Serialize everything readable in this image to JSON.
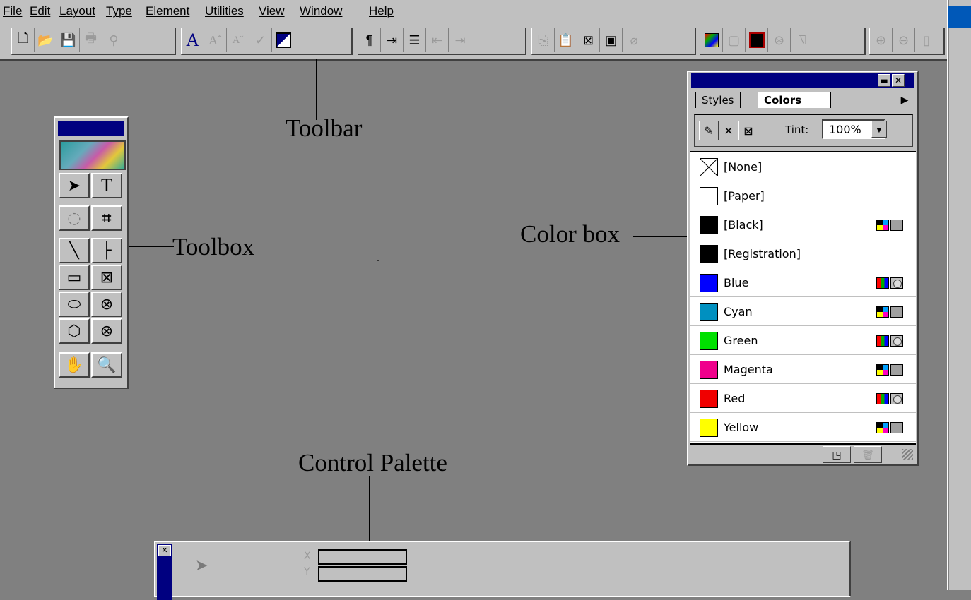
{
  "menu": [
    {
      "label": "File"
    },
    {
      "label": "Edit"
    },
    {
      "label": "Layout"
    },
    {
      "label": "Type"
    },
    {
      "label": "Element"
    },
    {
      "label": "Utilities"
    },
    {
      "label": "View"
    },
    {
      "label": "Window"
    },
    {
      "label": "Help"
    }
  ],
  "annotations": {
    "toolbar": "Toolbar",
    "toolbox": "Toolbox",
    "color_box": "Color box",
    "control_palette": "Control Palette"
  },
  "toolbar_icons": [
    "new-icon",
    "open-icon",
    "save-icon",
    "print-icon",
    "find-icon",
    "font-icon",
    "font-bigger-icon",
    "font-smaller-icon",
    "spell-check-icon",
    "fill-icon",
    "paragraph-icon",
    "insert-icon",
    "list-icon",
    "outdent-icon",
    "indent-icon",
    "copy-icon",
    "paste-icon",
    "frame-icon",
    "image-icon",
    "link-icon",
    "picture-icon",
    "picture-frame-icon",
    "color-icon",
    "globe-icon",
    "acrobat-icon",
    "zoom-in-icon",
    "zoom-out-icon"
  ],
  "palette": {
    "tabs": {
      "styles": "Styles",
      "colors": "Colors"
    },
    "tint_label": "Tint:",
    "tint_value": "100%",
    "colors": [
      {
        "name": "[None]",
        "swatch": "none",
        "model": ""
      },
      {
        "name": "[Paper]",
        "swatch": "#ffffff",
        "model": ""
      },
      {
        "name": "[Black]",
        "swatch": "#000000",
        "model": "cmyk"
      },
      {
        "name": "[Registration]",
        "swatch": "#000000",
        "model": ""
      },
      {
        "name": "Blue",
        "swatch": "#0000ff",
        "model": "rgb"
      },
      {
        "name": "Cyan",
        "swatch": "#0090c0",
        "model": "cmyk"
      },
      {
        "name": "Green",
        "swatch": "#00e000",
        "model": "rgb"
      },
      {
        "name": "Magenta",
        "swatch": "#f0008c",
        "model": "cmyk"
      },
      {
        "name": "Red",
        "swatch": "#f00000",
        "model": "rgb"
      },
      {
        "name": "Yellow",
        "swatch": "#ffff00",
        "model": "cmyk"
      }
    ]
  },
  "control": {
    "x_label": "X",
    "y_label": "Y"
  }
}
